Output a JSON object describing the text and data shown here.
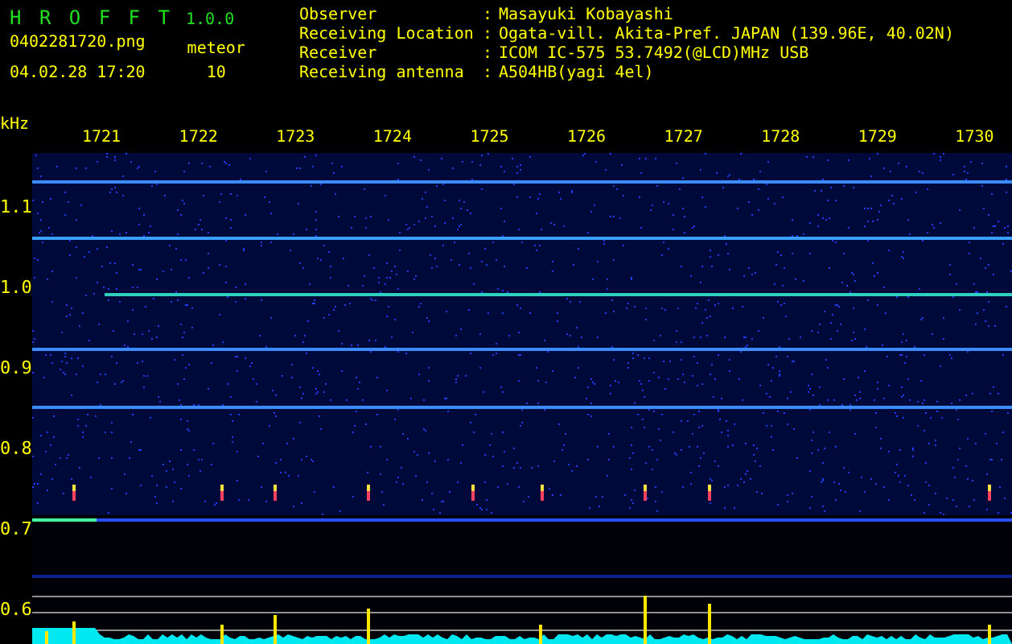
{
  "app": {
    "name": "H R O F F T",
    "version": "1.0.0"
  },
  "file": {
    "filename": "0402281720.png",
    "datetime": "04.02.28 17:20"
  },
  "meteor": {
    "label": "meteor",
    "count": "10"
  },
  "station_info": [
    {
      "label": "Observer",
      "separator": ":",
      "value": "Masayuki Kobayashi"
    },
    {
      "label": "Receiving Location",
      "separator": ":",
      "value": "Ogata-vill. Akita-Pref. JAPAN (139.96E, 40.02N)"
    },
    {
      "label": "Receiver",
      "separator": ":",
      "value": "ICOM IC-575 53.7492(@LCD)MHz USB"
    },
    {
      "label": "Receiving antenna",
      "separator": ":",
      "value": "A504HB(yagi 4el)"
    }
  ],
  "spectrogram": {
    "unit": "kHz",
    "time_labels": [
      "1721",
      "1722",
      "1723",
      "1724",
      "1725",
      "1726",
      "1727",
      "1728",
      "1729",
      "1730"
    ],
    "frequency_labels": [
      "1.1",
      "1.0",
      "0.9",
      "0.8",
      "0.7",
      "0.6"
    ]
  }
}
